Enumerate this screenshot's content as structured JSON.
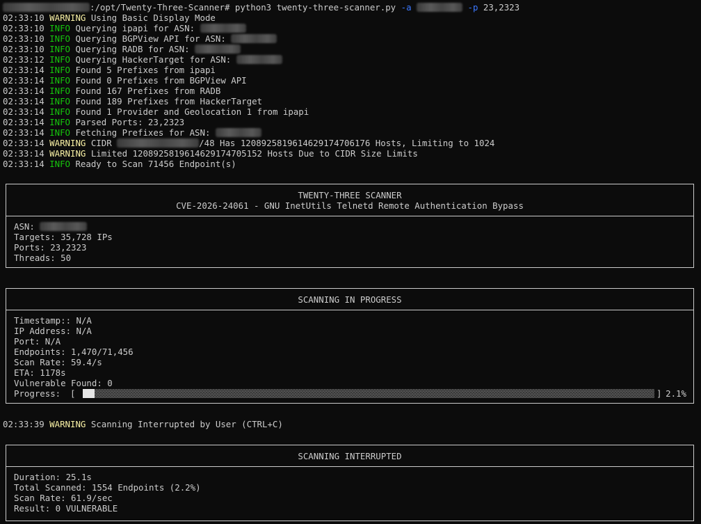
{
  "terminal": {
    "command_prompt_suffix": ":/opt/Twenty-Three-Scanner#",
    "command_main": "python3 twenty-three-scanner.py",
    "flag_asn": "-a",
    "flag_ports": "-p",
    "ports_arg": "23,2323",
    "log": [
      {
        "ts": "02:33:10",
        "level": "WARNING",
        "msg": "Using Basic Display Mode"
      },
      {
        "ts": "02:33:10",
        "level": "INFO",
        "msg": "Querying ipapi for ASN:"
      },
      {
        "ts": "02:33:10",
        "level": "INFO",
        "msg": "Querying BGPView API for ASN:"
      },
      {
        "ts": "02:33:10",
        "level": "INFO",
        "msg": "Querying RADB for ASN:"
      },
      {
        "ts": "02:33:12",
        "level": "INFO",
        "msg": "Querying HackerTarget for ASN:"
      },
      {
        "ts": "02:33:14",
        "level": "INFO",
        "msg": "Found 5 Prefixes from ipapi"
      },
      {
        "ts": "02:33:14",
        "level": "INFO",
        "msg": "Found 0 Prefixes from BGPView API"
      },
      {
        "ts": "02:33:14",
        "level": "INFO",
        "msg": "Found 167 Prefixes from RADB"
      },
      {
        "ts": "02:33:14",
        "level": "INFO",
        "msg": "Found 189 Prefixes from HackerTarget"
      },
      {
        "ts": "02:33:14",
        "level": "INFO",
        "msg": "Found 1 Provider and Geolocation 1 from ipapi"
      },
      {
        "ts": "02:33:14",
        "level": "INFO",
        "msg": "Parsed Ports: 23,2323"
      },
      {
        "ts": "02:33:14",
        "level": "INFO",
        "msg": "Fetching Prefixes for ASN:"
      },
      {
        "ts": "02:33:14",
        "level": "WARNING",
        "msg_pre": "CIDR",
        "msg_post": "/48 Has 1208925819614629174706176 Hosts, Limiting to 1024"
      },
      {
        "ts": "02:33:14",
        "level": "WARNING",
        "msg": "Limited 1208925819614629174705152 Hosts Due to CIDR Size Limits"
      },
      {
        "ts": "02:33:14",
        "level": "INFO",
        "msg": "Ready to Scan 71456 Endpoint(s)"
      }
    ],
    "interrupt_log": {
      "ts": "02:33:39",
      "level": "WARNING",
      "msg": "Scanning Interrupted by User (CTRL+C)"
    }
  },
  "banner": {
    "title": "TWENTY-THREE SCANNER",
    "subtitle": "CVE-2026-24061 - GNU InetUtils Telnetd Remote Authentication Bypass",
    "asn_label": "ASN:",
    "targets": "Targets: 35,728 IPs",
    "ports": "Ports: 23,2323",
    "threads": "Threads: 50"
  },
  "progress_panel": {
    "title": "SCANNING IN PROGRESS",
    "timestamp": "Timestamp:: N/A",
    "ip_address": "IP Address: N/A",
    "port": "Port: N/A",
    "endpoints": "Endpoints: 1,470/71,456",
    "scan_rate": "Scan Rate: 59.4/s",
    "eta": "ETA: 1178s",
    "vulnerable": "Vulnerable Found: 0",
    "progress_label": "Progress:",
    "bracket_open": "[",
    "bracket_close": "]",
    "progress_fraction": 0.021,
    "progress_percent": "2.1%"
  },
  "summary_panel": {
    "title": "SCANNING INTERRUPTED",
    "duration": "Duration: 25.1s",
    "total_scanned": "Total Scanned: 1554 Endpoints (2.2%)",
    "scan_rate": "Scan Rate: 61.9/sec",
    "result": "Result: 0 VULNERABLE"
  },
  "colors": {
    "background": "#0c0c0c",
    "text": "#cccccc",
    "info": "#16c60c",
    "warning": "#f9f1a5",
    "flag": "#3b78ff"
  }
}
